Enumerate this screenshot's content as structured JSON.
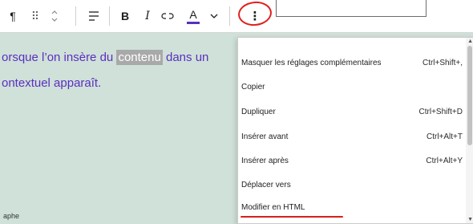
{
  "toolbar": {
    "paragraph_icon": "¶",
    "drag_icon": "⠿",
    "move_icon": "⌃",
    "bold_label": "B",
    "italic_label": "I",
    "text_color_label": "A",
    "text_color_hex": "#5b2fc0",
    "more_icon": "⋮",
    "highlight_color": "#e0201e"
  },
  "editor": {
    "line1_before": "orsque l’on insère du ",
    "line1_selected": "contenu",
    "line1_after": " dans un",
    "line2": "ontextuel apparaît.",
    "status_text": "aphe",
    "text_color": "#5b2fc0"
  },
  "menu": {
    "items": [
      {
        "label": "Masquer les réglages complémentaires",
        "shortcut": "Ctrl+Shift+,"
      },
      {
        "label": "Copier",
        "shortcut": ""
      },
      {
        "label": "Dupliquer",
        "shortcut": "Ctrl+Shift+D"
      },
      {
        "label": "Insérer avant",
        "shortcut": "Ctrl+Alt+T"
      },
      {
        "label": "Insérer après",
        "shortcut": "Ctrl+Alt+Y"
      },
      {
        "label": "Déplacer vers",
        "shortcut": ""
      },
      {
        "label": "Modifier en HTML",
        "shortcut": ""
      }
    ],
    "scroll_up": "▲",
    "scroll_down": "▼"
  }
}
